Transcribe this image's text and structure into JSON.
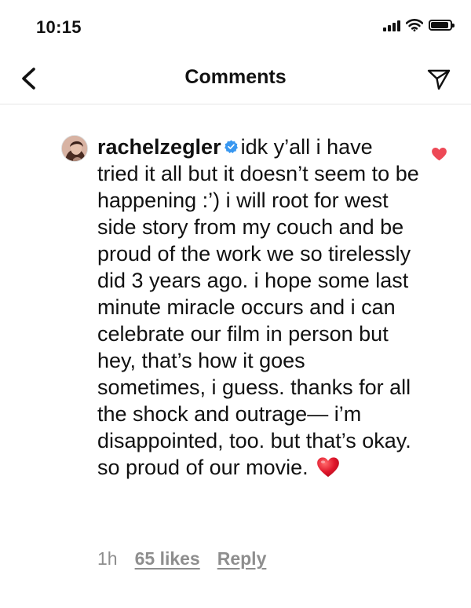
{
  "status_bar": {
    "time": "10:15"
  },
  "header": {
    "title": "Comments",
    "back_icon": "chevron-left-icon",
    "share_icon": "paper-plane-icon"
  },
  "comment": {
    "username": "rachelzegler",
    "verified_icon": "verified-badge-icon",
    "text": "idk y’all i have tried it all but it doesn’t seem to be happening :’) i will root for west side story from my couch and be proud of the work we so tirelessly did 3 years ago. i hope some last minute miracle occurs and i can celebrate our film in person but hey, that’s how it goes sometimes, i guess. thanks for all the shock and outrage— i’m disappointed, too. but that’s okay. so proud of our movie.",
    "emoji": "red-heart-emoji",
    "time_ago": "1h",
    "likes": "65 likes",
    "reply_label": "Reply",
    "liked": true
  },
  "colors": {
    "heart_red": "#ed4956",
    "verified_blue": "#3897f0",
    "meta_gray": "#8e8e8e",
    "text": "#111111"
  }
}
